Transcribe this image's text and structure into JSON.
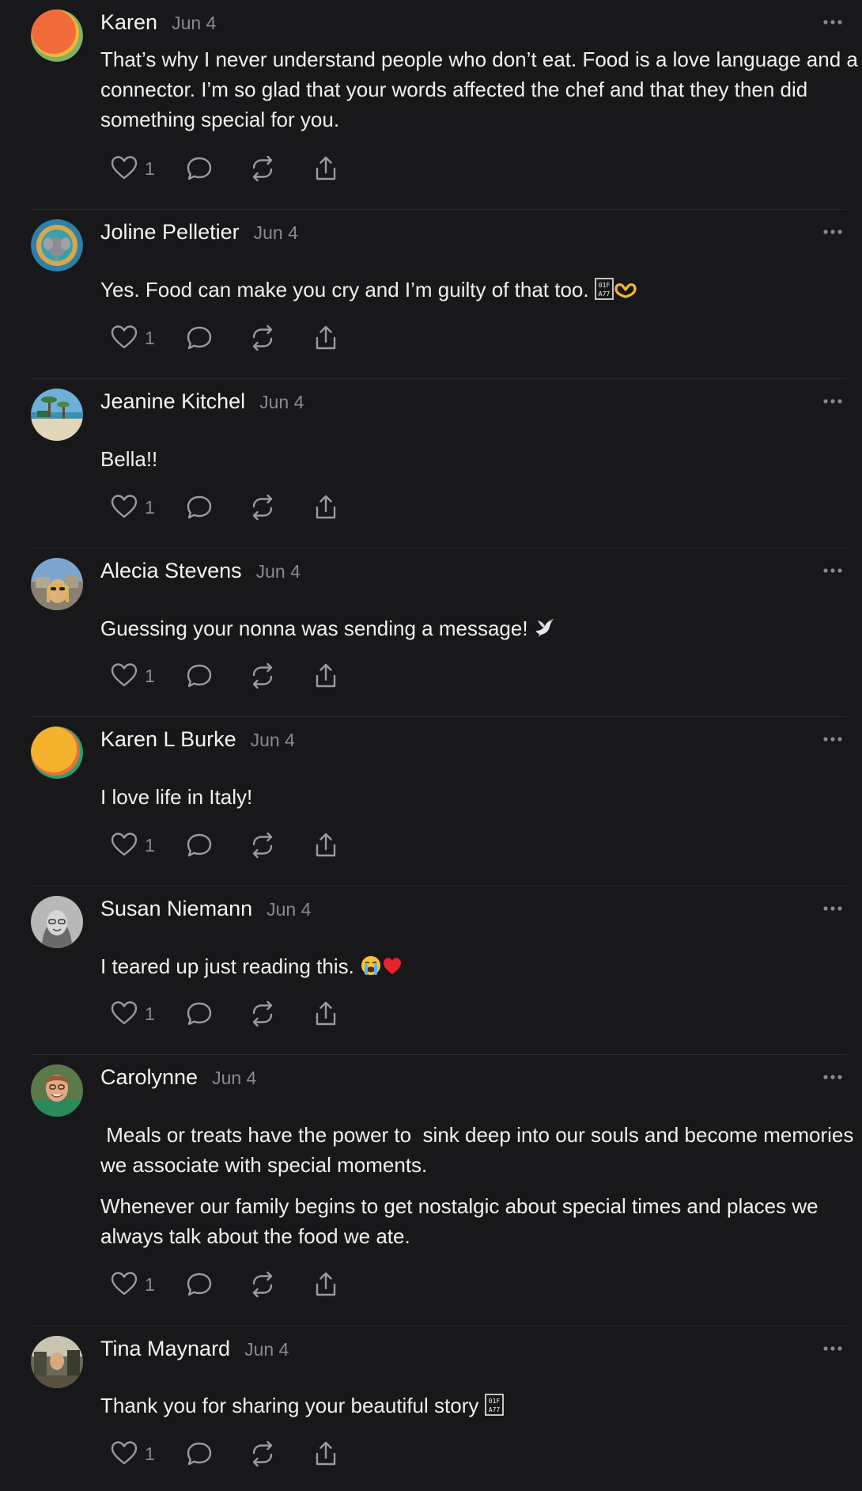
{
  "comments": [
    {
      "author": "Karen",
      "date": "Jun 4",
      "paragraphs": [
        "That’s why I never understand people who don’t eat. Food is a love language and a connector. I’m so glad that your words affected the chef and that they then did something special for you."
      ],
      "likes": "1"
    },
    {
      "author": "Joline Pelletier",
      "date": "Jun 4",
      "paragraphs": [
        "Yes. Food can make you cry and I’m guilty of that too. "
      ],
      "likes": "1"
    },
    {
      "author": "Jeanine Kitchel",
      "date": "Jun 4",
      "paragraphs": [
        "Bella!!"
      ],
      "likes": "1"
    },
    {
      "author": "Alecia Stevens",
      "date": "Jun 4",
      "paragraphs": [
        "Guessing your nonna was sending a message! "
      ],
      "likes": "1"
    },
    {
      "author": "Karen L Burke",
      "date": "Jun 4",
      "paragraphs": [
        "I love life in Italy!"
      ],
      "likes": "1"
    },
    {
      "author": "Susan Niemann",
      "date": "Jun 4",
      "paragraphs": [
        "I teared up just reading this. "
      ],
      "likes": "1"
    },
    {
      "author": "Carolynne",
      "date": "Jun 4",
      "paragraphs": [
        " Meals or treats have the power to  sink deep into our souls and become memories we associate with special moments.",
        "Whenever our family begins to get nostalgic about special times and places we always talk about the food we ate."
      ],
      "likes": "1"
    },
    {
      "author": "Tina Maynard",
      "date": "Jun 4",
      "paragraphs": [
        "Thank you for sharing your beautiful story "
      ],
      "likes": "1"
    }
  ],
  "icons": {
    "like": "heart-icon",
    "reply": "comment-bubble-icon",
    "repost": "repost-icon",
    "share": "share-icon",
    "more": "more-options-icon"
  },
  "colors": {
    "background": "#18181b",
    "text": "#f0f0f0",
    "muted": "#8a8a8e",
    "divider": "#2a2a2e"
  }
}
